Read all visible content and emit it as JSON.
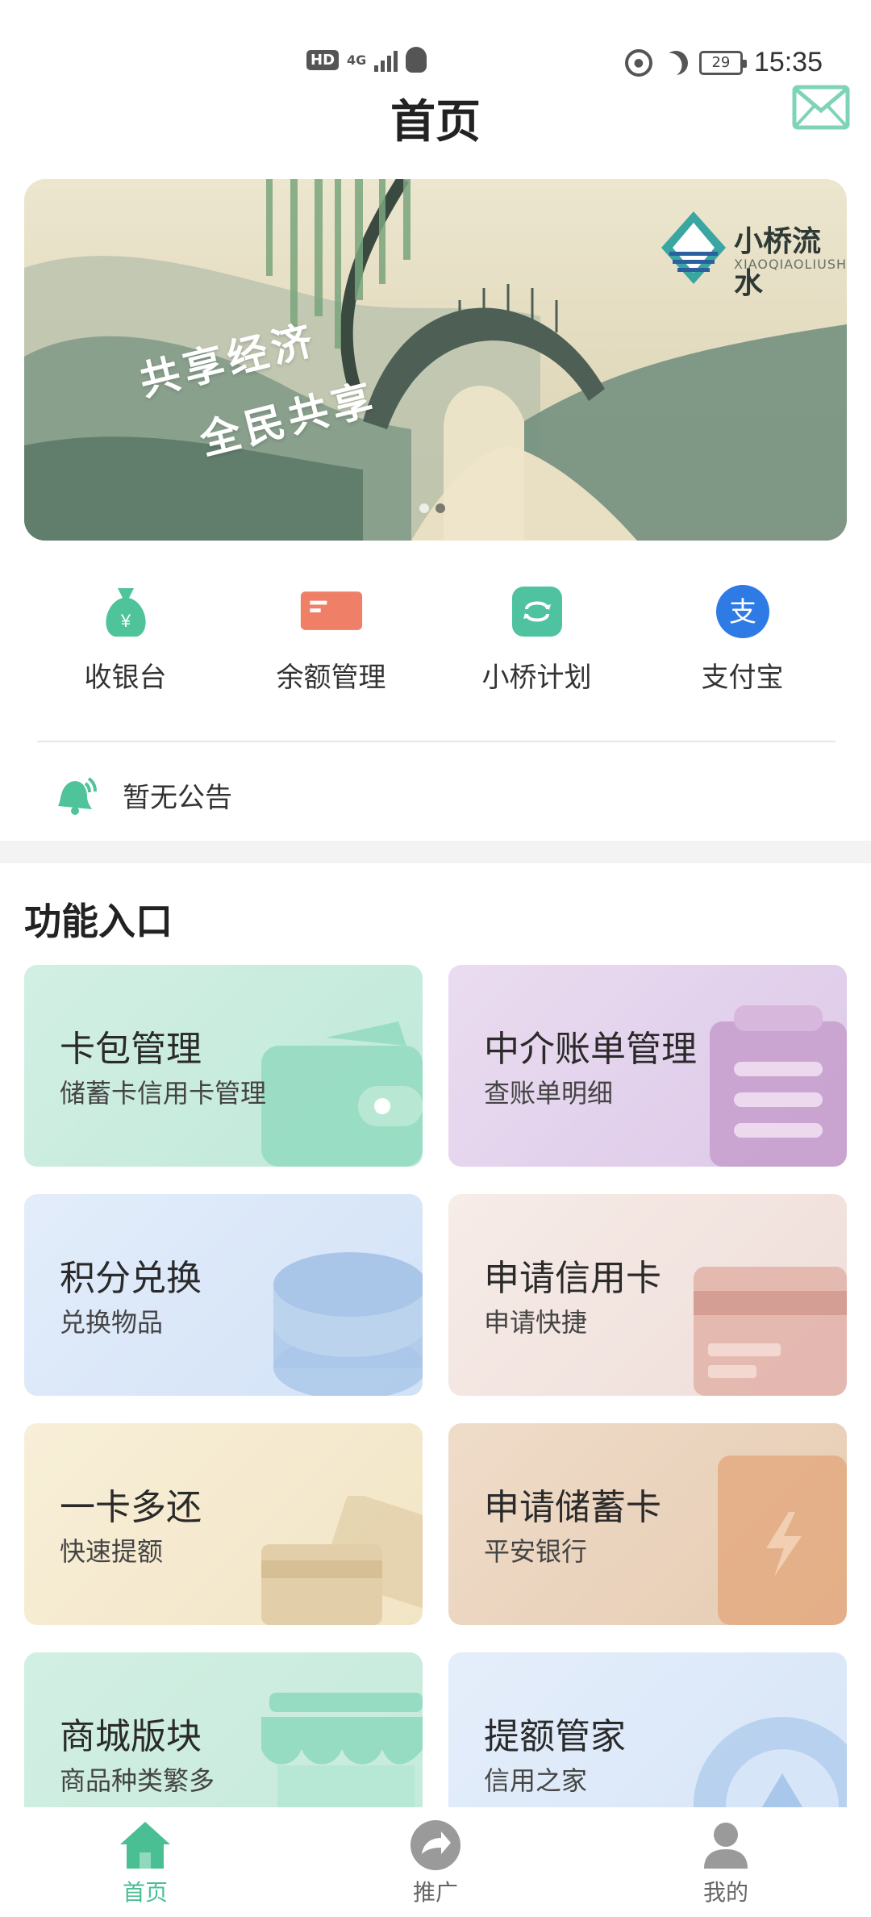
{
  "status_bar": {
    "left_badge": "HD",
    "network": "4G",
    "battery": "29",
    "time": "15:35"
  },
  "header": {
    "title": "首页",
    "mail_icon": "mail-icon"
  },
  "banner": {
    "slogan_line1": "共享经济",
    "slogan_line2": "全民共享",
    "brand_cn": "小桥流水",
    "brand_en": "XIAOQIAOLIUSHUI",
    "dots_total": 2,
    "active_dot": 2
  },
  "quick_actions": [
    {
      "label": "收银台",
      "icon": "money-bag-icon",
      "color": "#4fc39a"
    },
    {
      "label": "余额管理",
      "icon": "card-icon",
      "color": "#ef7f66"
    },
    {
      "label": "小桥计划",
      "icon": "cycle-icon",
      "color": "#4fc3a0"
    },
    {
      "label": "支付宝",
      "icon": "alipay-icon",
      "color": "#2e7be6"
    }
  ],
  "notice": {
    "text": "暂无公告",
    "icon": "bell-icon"
  },
  "section": {
    "title": "功能入口"
  },
  "cards": [
    {
      "title": "卡包管理",
      "subtitle": "储蓄卡信用卡管理",
      "icon": "wallet-icon",
      "bg1": "#d2efe3",
      "bg2": "#bfe9d9",
      "accent": "#8fd9be"
    },
    {
      "title": "中介账单管理",
      "subtitle": "查账单明细",
      "icon": "clipboard-icon",
      "bg1": "#eadcf0",
      "bg2": "#dcc8e8",
      "accent": "#c79ecc"
    },
    {
      "title": "积分兑换",
      "subtitle": "兑换物品",
      "icon": "coins-icon",
      "bg1": "#e3edfb",
      "bg2": "#d2e2f6",
      "accent": "#a9c6e8"
    },
    {
      "title": "申请信用卡",
      "subtitle": "申请快捷",
      "icon": "credit-card-icon",
      "bg1": "#f6ece8",
      "bg2": "#efddd8",
      "accent": "#e2b1a8"
    },
    {
      "title": "一卡多还",
      "subtitle": "快速提额",
      "icon": "cards-icon",
      "bg1": "#f8efd8",
      "bg2": "#f2e5c6",
      "accent": "#e2cfaa"
    },
    {
      "title": "申请储蓄卡",
      "subtitle": "平安银行",
      "icon": "power-card-icon",
      "bg1": "#efdcc9",
      "bg2": "#e6cbb2",
      "accent": "#e3a67a"
    },
    {
      "title": "商城版块",
      "subtitle": "商品种类繁多",
      "icon": "shop-icon",
      "bg1": "#d2efe3",
      "bg2": "#c5eadb",
      "accent": "#96dcc2"
    },
    {
      "title": "提额管家",
      "subtitle": "信用之家",
      "icon": "arch-icon",
      "bg1": "#e5eefb",
      "bg2": "#d6e5f7",
      "accent": "#a9c7ea"
    }
  ],
  "tabbar": [
    {
      "label": "首页",
      "icon": "home-icon",
      "active": true
    },
    {
      "label": "推广",
      "icon": "share-icon",
      "active": false
    },
    {
      "label": "我的",
      "icon": "user-icon",
      "active": false
    }
  ],
  "colors": {
    "accent": "#4bbf94",
    "inactive": "#9a9a9a"
  }
}
